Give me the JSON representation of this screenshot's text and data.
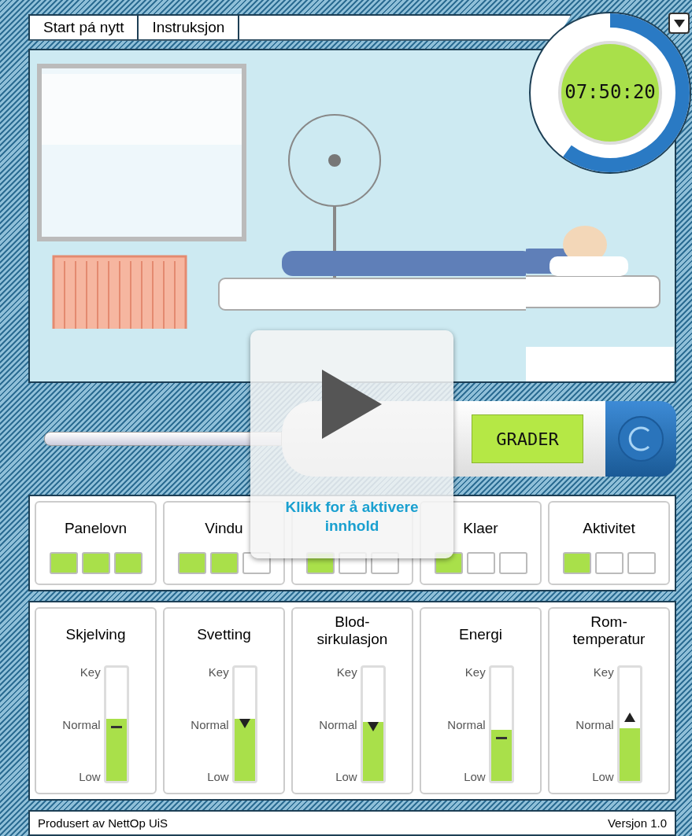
{
  "menu": [
    {
      "label": "Start pá nytt"
    },
    {
      "label": "Instruksjon"
    }
  ],
  "timer": {
    "time": "07:50:20",
    "level": 0.6
  },
  "thermometer": {
    "unit": "GRADER"
  },
  "overlay": {
    "message": "Klikk for å aktivere innhold"
  },
  "controls": [
    {
      "label": "Panelovn",
      "steps": [
        true,
        true,
        true
      ]
    },
    {
      "label": "Vindu",
      "steps": [
        true,
        true,
        false
      ]
    },
    {
      "steps": [
        true,
        false,
        false
      ]
    },
    {
      "label": "Klaer",
      "steps": [
        true,
        false,
        false
      ]
    },
    {
      "label": "Aktivitet",
      "steps": [
        true,
        false,
        false
      ]
    }
  ],
  "gauges": [
    {
      "label": "Skjelving",
      "scale": [
        "Key",
        "Normal",
        "Low"
      ],
      "level": 0.55,
      "kind": "dash"
    },
    {
      "label": "Svetting",
      "scale": [
        "Key",
        "Normal",
        "Low"
      ],
      "level": 0.55,
      "kind": "down"
    },
    {
      "label": "Blod-\nsirkulasjon",
      "scale": [
        "Key",
        "Normal",
        "Low"
      ],
      "level": 0.52,
      "kind": "down"
    },
    {
      "label": "Energi",
      "scale": [
        "Key",
        "Normal",
        "Low"
      ],
      "level": 0.45,
      "kind": "dash"
    },
    {
      "label": "Rom-\ntemperatur",
      "scale": [
        "Key",
        "Normal",
        "Low"
      ],
      "level": 0.47,
      "kind": "up"
    }
  ],
  "footer": {
    "credit": "Produsert av NettOp UiS",
    "version": "Versjon 1.0"
  }
}
